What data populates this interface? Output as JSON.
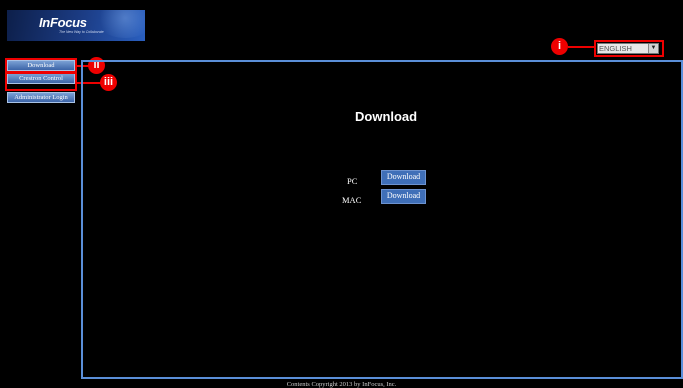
{
  "header": {
    "logo_name": "InFocus",
    "logo_tagline": "The New Way to Collaborate"
  },
  "language": {
    "selected": "ENGLISH",
    "arrow": "▼"
  },
  "markers": {
    "i": "i",
    "ii": "ii",
    "iii": "iii"
  },
  "sidebar": {
    "items": [
      {
        "label": "Download"
      },
      {
        "label": "Crestron Control"
      },
      {
        "label": "Administrator Login"
      }
    ]
  },
  "main": {
    "title": "Download",
    "rows": [
      {
        "label": "PC",
        "button": "Download"
      },
      {
        "label": "MAC",
        "button": "Download"
      }
    ]
  },
  "footer": {
    "text": "Contents Copyright 2013 by InFocus, Inc."
  },
  "colors": {
    "accent": "#5b8fd9",
    "button": "#3f6fb8",
    "annotation": "#e00000"
  }
}
